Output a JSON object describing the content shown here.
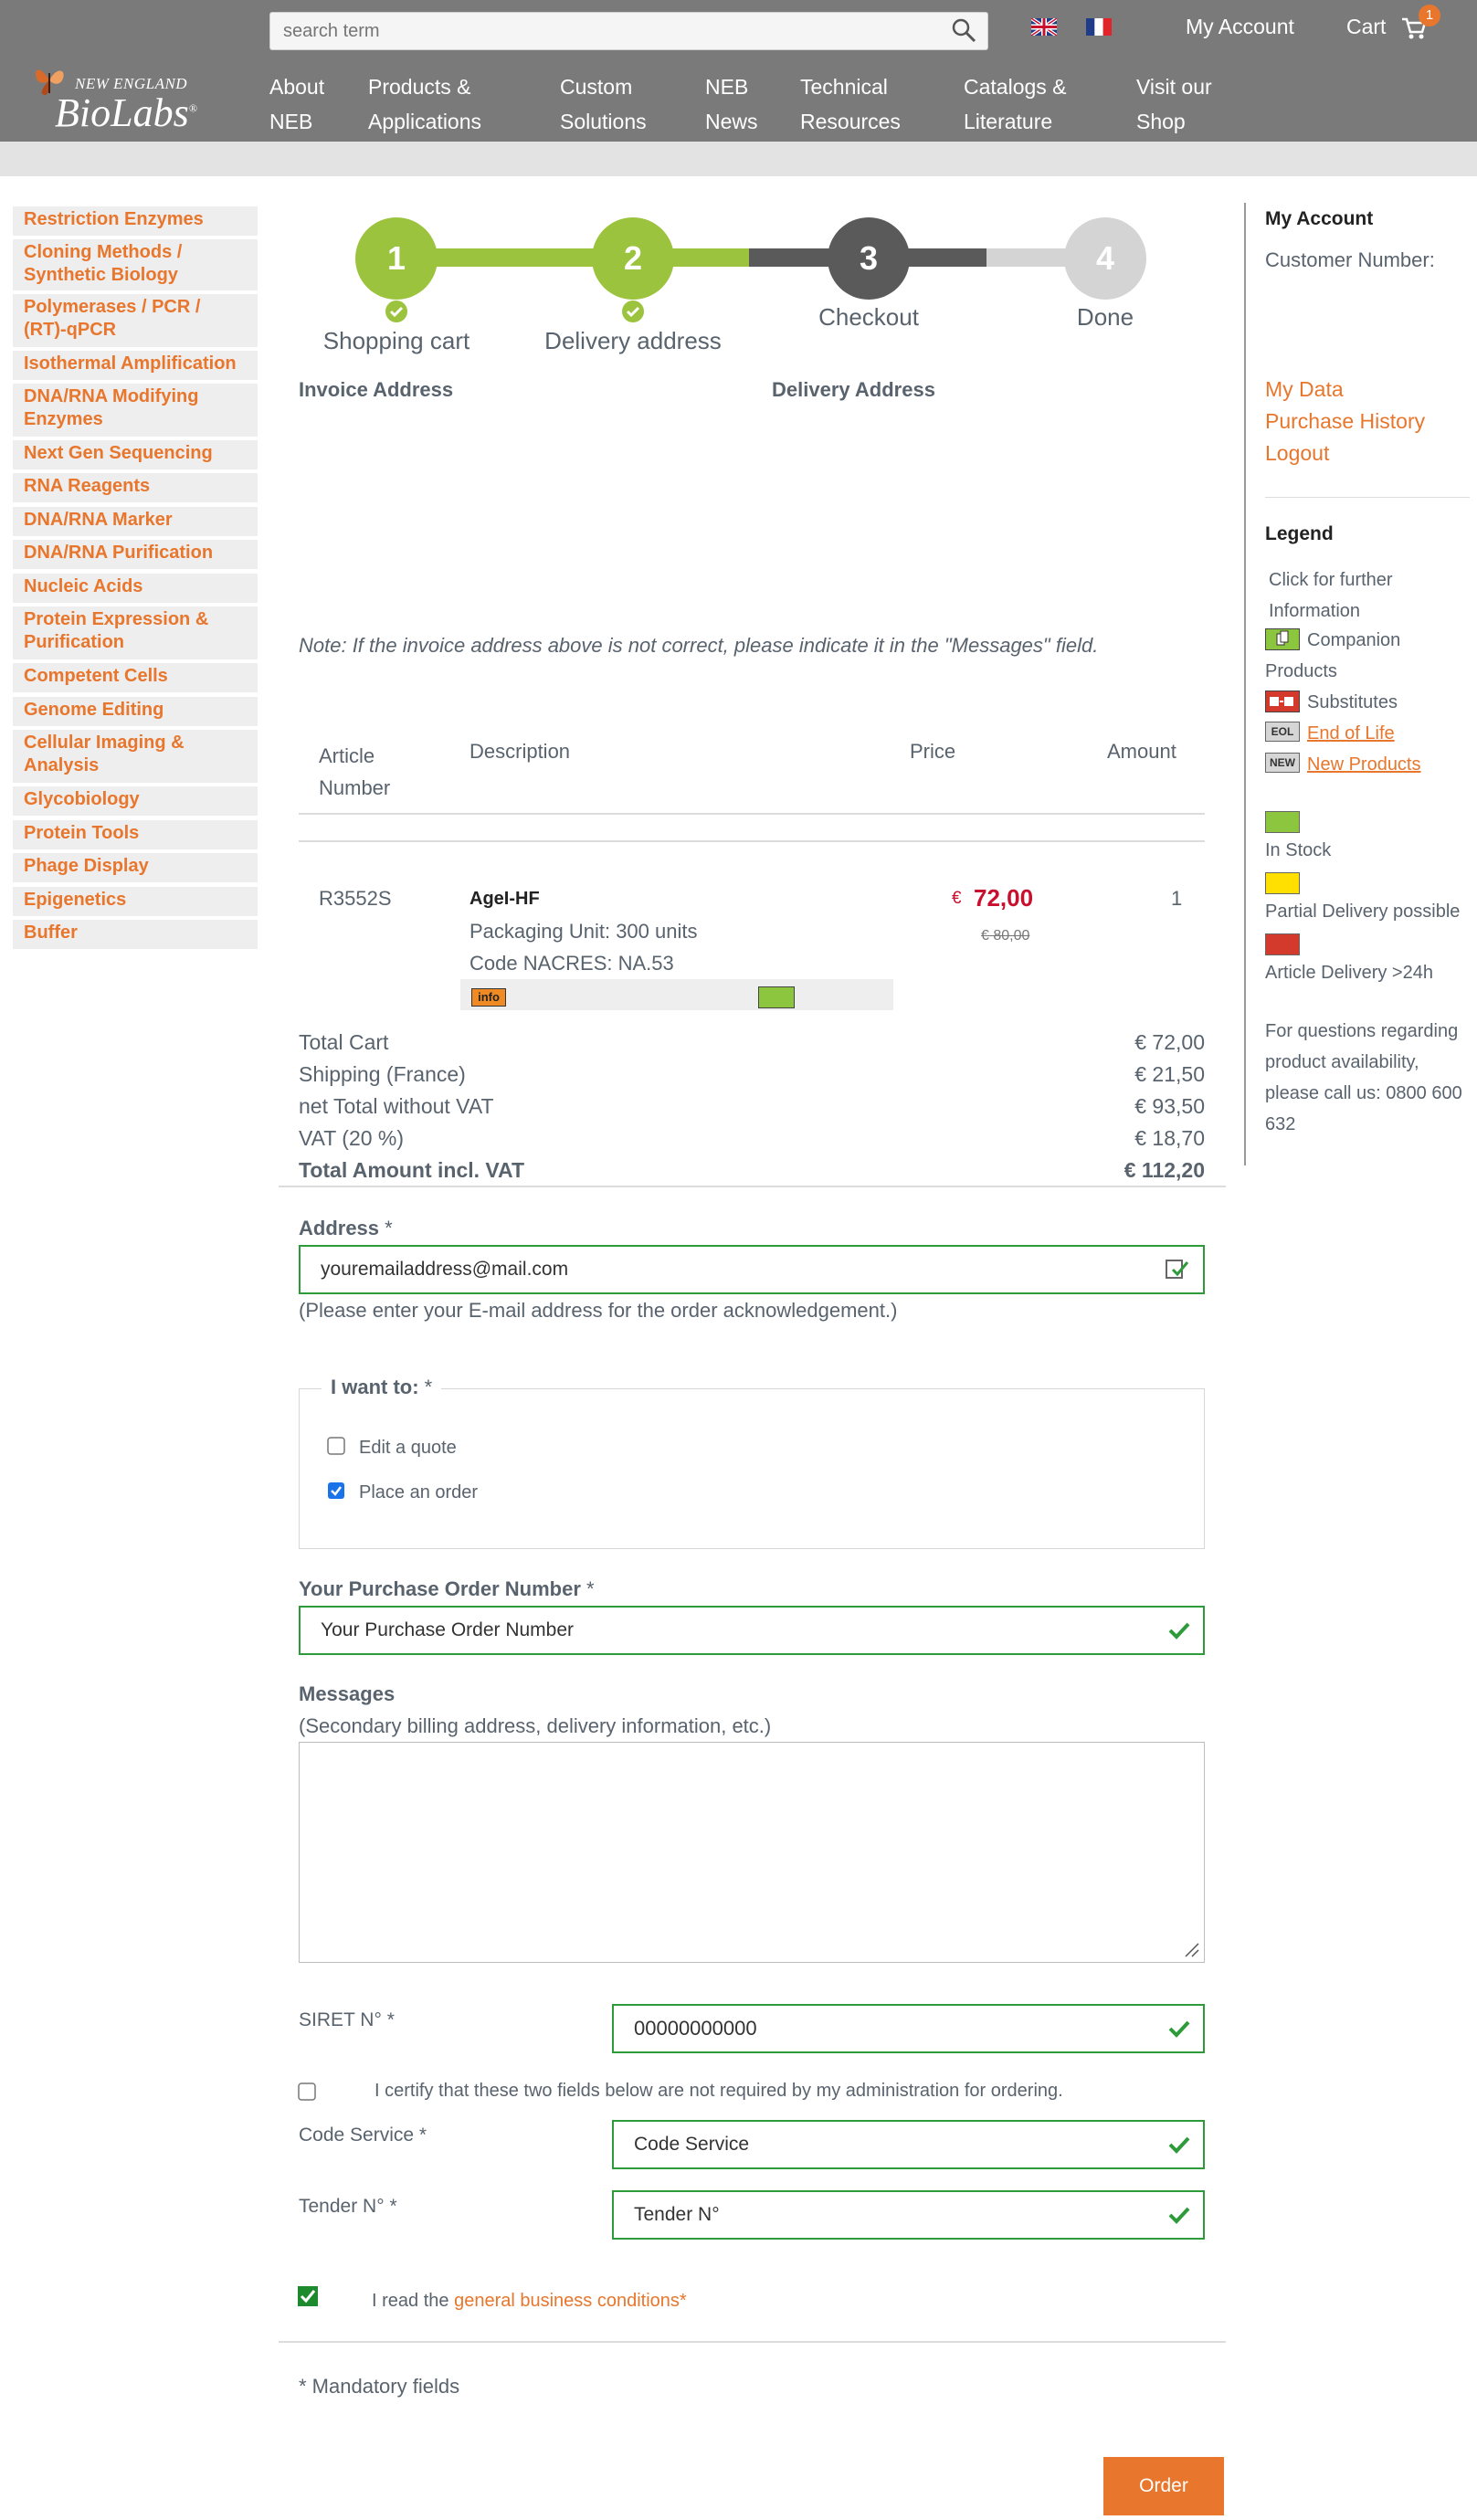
{
  "header": {
    "search_placeholder": "search term",
    "my_account": "My Account",
    "cart": "Cart",
    "cart_count": "1",
    "logo_line1": "NEW ENGLAND",
    "logo_line2": "BioLabs",
    "logo_mark": "®",
    "nav": [
      {
        "line1": "About",
        "line2": "NEB"
      },
      {
        "line1": "Products &",
        "line2": "Applications"
      },
      {
        "line1": "Custom",
        "line2": "Solutions"
      },
      {
        "line1": "NEB",
        "line2": "News"
      },
      {
        "line1": "Technical",
        "line2": "Resources"
      },
      {
        "line1": "Catalogs &",
        "line2": "Literature"
      },
      {
        "line1": "Visit our",
        "line2": "Shop"
      }
    ]
  },
  "sidebar": [
    "Restriction Enzymes",
    "Cloning Methods / Synthetic Biology",
    "Polymerases / PCR / (RT)-qPCR",
    "Isothermal Amplification",
    "DNA/RNA Modifying Enzymes",
    "Next Gen Sequencing",
    "RNA Reagents",
    "DNA/RNA Marker",
    "DNA/RNA Purification",
    "Nucleic Acids",
    "Protein Expression & Purification",
    "Competent Cells",
    "Genome Editing",
    "Cellular Imaging & Analysis",
    "Glycobiology",
    "Protein Tools",
    "Phage Display",
    "Epigenetics",
    "Buffer"
  ],
  "steps": [
    {
      "num": "1",
      "label": "Shopping cart",
      "color": "#9bc33d"
    },
    {
      "num": "2",
      "label": "Delivery address",
      "color": "#9bc33d"
    },
    {
      "num": "3",
      "label": "Checkout",
      "color": "#5a5a5a"
    },
    {
      "num": "4",
      "label": "Done",
      "color": "#d4d4d4"
    }
  ],
  "addresses": {
    "invoice": "Invoice Address",
    "delivery": "Delivery Address",
    "note": "Note: If the invoice address above is not correct, please indicate it in the \"Messages\" field."
  },
  "table": {
    "headers": {
      "article_1": "Article",
      "article_2": "Number",
      "description": "Description",
      "price": "Price",
      "amount": "Amount"
    },
    "row": {
      "article": "R3552S",
      "name": "AgeI-HF",
      "packaging": "Packaging Unit: 300 units",
      "code": "Code NACRES: NA.53",
      "currency": "€",
      "price": "72,00",
      "old_price": "€ 80,00",
      "amount": "1",
      "info": "info"
    }
  },
  "totals": [
    {
      "label": "Total Cart",
      "value": "€ 72,00",
      "bold": false
    },
    {
      "label": "Shipping (France)",
      "value": "€ 21,50",
      "bold": false
    },
    {
      "label": "net Total without VAT",
      "value": "€ 93,50",
      "bold": false
    },
    {
      "label": "VAT (20 %)",
      "value": "€ 18,70",
      "bold": false
    },
    {
      "label": "Total Amount incl. VAT",
      "value": "€ 112,20",
      "bold": true
    }
  ],
  "form": {
    "address_label": "Address",
    "required_mark": "*",
    "email_value": "youremailaddress@mail.com",
    "email_hint": "(Please enter your E-mail address for the order acknowledgement.)",
    "want_legend": "I want to:",
    "option_quote": "Edit a quote",
    "option_order": "Place an order",
    "po_label": "Your Purchase Order Number",
    "po_value": "Your Purchase Order Number",
    "messages_label": "Messages",
    "messages_hint": "(Secondary billing address, delivery information, etc.)",
    "siret_label": "SIRET N° *",
    "siret_value": "00000000000",
    "certify_text": "I certify that these two fields below are not required by my administration for ordering.",
    "code_service_label": "Code Service *",
    "code_service_value": "Code Service",
    "tender_label": "Tender N° *",
    "tender_value": "Tender N°",
    "read_prefix": "I read the",
    "read_link": "general business conditions",
    "mandatory": "* Mandatory fields",
    "order_button": "Order"
  },
  "right": {
    "title": "My Account",
    "customer_number": "Customer Number:",
    "links": [
      "My Data",
      "Purchase History",
      "Logout"
    ],
    "legend_title": "Legend",
    "legend_intro_1": "Click for further",
    "legend_intro_2": "Information",
    "companion_1": "Companion",
    "companion_2": "Products",
    "substitutes": "Substitutes",
    "eol_badge": "EOL",
    "eol": "End of Life",
    "new_badge": "NEW",
    "new_products": "New Products",
    "in_stock": "In Stock",
    "partial": "Partial Delivery possible",
    "delivery_24h": "Article Delivery >24h",
    "q1": "For questions regarding",
    "q2": "product availability,",
    "q3": "please call us: 0800 600",
    "q4": "632"
  },
  "colors": {
    "accent": "#e8762d",
    "green": "#9bc33d",
    "stock_green": "#8cc63f",
    "stock_yellow": "#ffe000",
    "stock_red": "#d33a2c",
    "price_red": "#c8102e"
  }
}
